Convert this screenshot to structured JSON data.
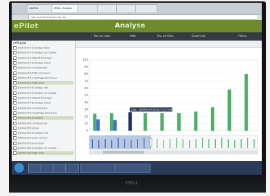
{
  "browser": {
    "tabs": [
      "LabPilot",
      "ePilot - Analyse",
      "",
      "",
      "",
      ""
    ],
    "url": "https://epilot/fr/analyse/index.php"
  },
  "app": {
    "brand": "ePilot",
    "title": "Analyse"
  },
  "toolbar": {
    "items": [
      "Pas de ratio",
      "kWh",
      "Pas de filtre",
      "Electricité"
    ],
    "right_label": "Filtres"
  },
  "sidebar": {
    "heading": "critique",
    "items": [
      {
        "label": "Batiment A éclairage total",
        "selected": false
      },
      {
        "label": "Batiment A éclairage sur façade",
        "selected": false
      },
      {
        "label": "Batiment A départ éclairage",
        "selected": false
      },
      {
        "label": "Batiment A éclairage sortie",
        "selected": false
      },
      {
        "label": "Batiment A climatisation",
        "selected": false
      },
      {
        "label": "Batiment A Tgbt ascenseur",
        "selected": false
      },
      {
        "label": "Batiment A chauffage électrique",
        "selected": false
      },
      {
        "label": "Batiment A Tgbt total",
        "selected": true
      },
      {
        "label": "Batiment A éclairage hall",
        "selected": false
      },
      {
        "label": "Batiment A éclairage sur façade",
        "selected": false
      },
      {
        "label": "Batiment A départ éclairage",
        "selected": false
      },
      {
        "label": "Batiment A éclairage sortie",
        "selected": false
      },
      {
        "label": "Batiment A climatisation",
        "selected": false
      },
      {
        "label": "Batiment A chauffage électrique",
        "selected": false
      },
      {
        "label": "Batiment B éclairage",
        "selected": true
      },
      {
        "label": "Batiment B climatisation",
        "selected": false
      },
      {
        "label": "Batiment B prises",
        "selected": false
      },
      {
        "label": "Batiment B éclairage hall",
        "selected": false
      },
      {
        "label": "Batiment B salle serveur",
        "selected": false
      },
      {
        "label": "Batiment B ascenseur",
        "selected": false
      },
      {
        "label": "Batiment B éclairage sur façade",
        "selected": false
      },
      {
        "label": "Batiment B Tgbt total",
        "selected": true
      }
    ]
  },
  "tooltip": {
    "text": "Lège : 28/04/2014 00:00 / 22:27 kWh"
  },
  "taskbar": {
    "items": [
      "",
      "",
      "",
      "",
      "",
      ""
    ]
  },
  "colors": {
    "green": "#4caf66",
    "blue": "#3b6fd6",
    "navy": "#1c2f6b",
    "appbar": "#6f8a2c"
  },
  "chart_data": {
    "type": "bar",
    "ylim": [
      0,
      100
    ],
    "yticks": [
      0,
      10,
      20,
      30,
      40,
      50,
      60,
      70,
      80,
      90,
      100
    ],
    "categories": [
      "",
      "",
      "",
      "",
      "",
      "",
      "",
      "",
      "",
      ""
    ],
    "series": [
      {
        "values": [
          24,
          25,
          0,
          25,
          25,
          25,
          27,
          33,
          58,
          80
        ],
        "color": "#4caf66"
      },
      {
        "values": [
          16,
          15,
          0,
          0,
          0,
          0,
          0,
          0,
          0,
          0
        ],
        "color": "#3b6fd6"
      },
      {
        "values": [
          0,
          0,
          26,
          0,
          0,
          0,
          0,
          0,
          0,
          0
        ],
        "color": "#1c2f6b"
      }
    ]
  },
  "overview": {
    "values": [
      8,
      7,
      8,
      7,
      9,
      8,
      7,
      8,
      9,
      8,
      8,
      7,
      8,
      9,
      8,
      7,
      8,
      9,
      8,
      8,
      9,
      8,
      7,
      8,
      9,
      8
    ]
  }
}
